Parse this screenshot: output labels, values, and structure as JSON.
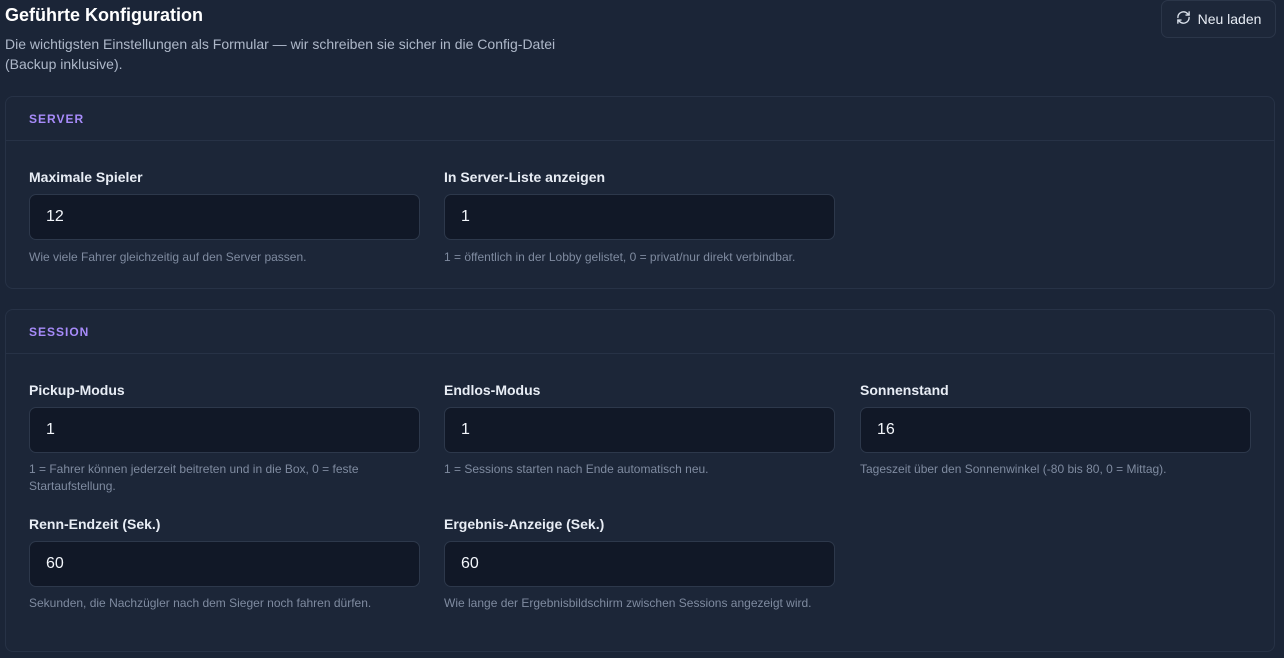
{
  "header": {
    "title": "Geführte Konfiguration",
    "description": "Die wichtigsten Einstellungen als Formular — wir schreiben sie sicher in die Config-Datei (Backup inklusive).",
    "reload_label": "Neu laden"
  },
  "sections": {
    "server": {
      "title": "SERVER",
      "fields": [
        {
          "label": "Maximale Spieler",
          "value": "12",
          "hint": "Wie viele Fahrer gleichzeitig auf den Server passen."
        },
        {
          "label": "In Server-Liste anzeigen",
          "value": "1",
          "hint": "1 = öffentlich in der Lobby gelistet, 0 = privat/nur direkt verbindbar."
        }
      ]
    },
    "session": {
      "title": "SESSION",
      "fields": [
        {
          "label": "Pickup-Modus",
          "value": "1",
          "hint": "1 = Fahrer können jederzeit beitreten und in die Box, 0 = feste Startaufstellung."
        },
        {
          "label": "Endlos-Modus",
          "value": "1",
          "hint": "1 = Sessions starten nach Ende automatisch neu."
        },
        {
          "label": "Sonnenstand",
          "value": "16",
          "hint": "Tageszeit über den Sonnenwinkel (-80 bis 80, 0 = Mittag)."
        },
        {
          "label": "Renn-Endzeit (Sek.)",
          "value": "60",
          "hint": "Sekunden, die Nachzügler nach dem Sieger noch fahren dürfen."
        },
        {
          "label": "Ergebnis-Anzeige (Sek.)",
          "value": "60",
          "hint": "Wie lange der Ergebnisbildschirm zwischen Sessions angezeigt wird."
        }
      ]
    }
  },
  "colors": {
    "background": "#1b2537",
    "card": "#1c2638",
    "input": "#111827",
    "accent": "#a78bfa"
  }
}
